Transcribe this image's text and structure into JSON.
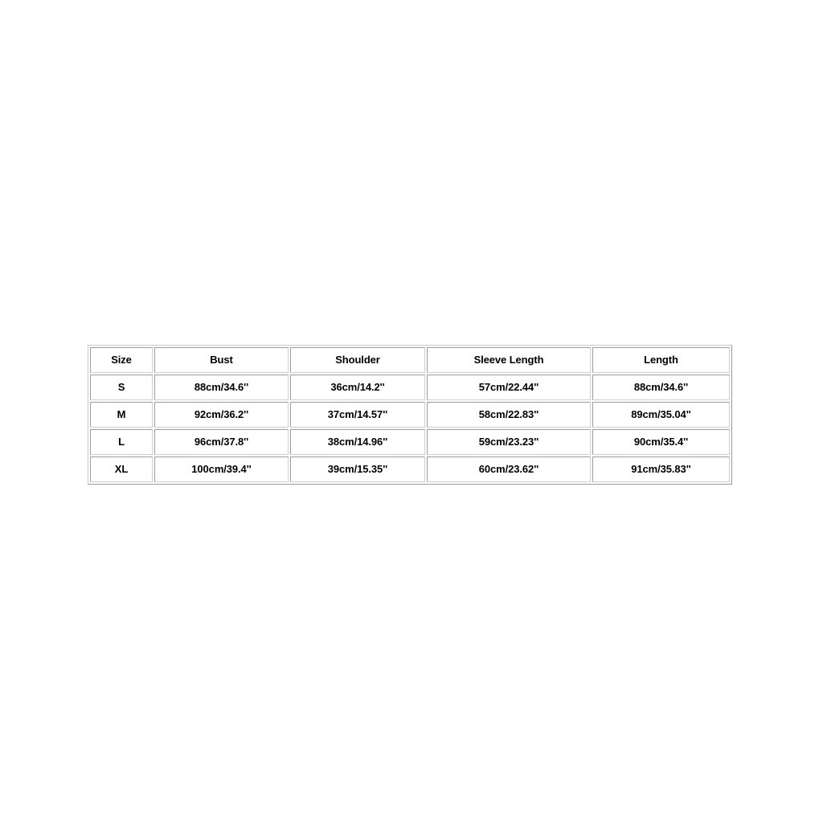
{
  "chart_data": {
    "type": "table",
    "title": "",
    "columns": [
      "Size",
      "Bust",
      "Shoulder",
      "Sleeve Length",
      "Length"
    ],
    "rows": [
      {
        "size": "S",
        "bust": "88cm/34.6''",
        "shoulder": "36cm/14.2''",
        "sleeve_length": "57cm/22.44''",
        "length": "88cm/34.6''"
      },
      {
        "size": "M",
        "bust": "92cm/36.2''",
        "shoulder": "37cm/14.57''",
        "sleeve_length": "58cm/22.83''",
        "length": "89cm/35.04''"
      },
      {
        "size": "L",
        "bust": "96cm/37.8''",
        "shoulder": "38cm/14.96''",
        "sleeve_length": "59cm/23.23''",
        "length": "90cm/35.4''"
      },
      {
        "size": "XL",
        "bust": "100cm/39.4''",
        "shoulder": "39cm/15.35''",
        "sleeve_length": "60cm/23.62''",
        "length": "91cm/35.83''"
      }
    ],
    "colors": {
      "background": "#ffffff",
      "text": "#000000",
      "border": "#9c9c9c",
      "border_light": "#cfcfcf"
    }
  }
}
